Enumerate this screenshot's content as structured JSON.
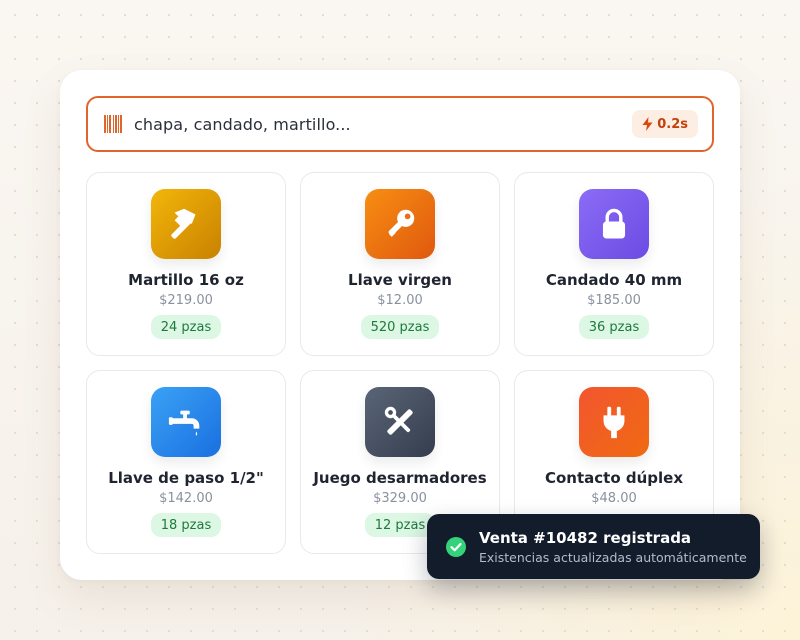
{
  "search": {
    "query": "chapa, candado, martillo...",
    "speed": "0.2s",
    "accent": "#e0652a"
  },
  "products": [
    {
      "name": "Martillo 16 oz",
      "price": "$219.00",
      "stock": "24 pzas",
      "icon": "hammer-icon",
      "gradient": [
        "#f2b60a",
        "#c98100"
      ]
    },
    {
      "name": "Llave virgen",
      "price": "$12.00",
      "stock": "520 pzas",
      "icon": "key-icon",
      "gradient": [
        "#f78e12",
        "#e0580f"
      ]
    },
    {
      "name": "Candado 40 mm",
      "price": "$185.00",
      "stock": "36 pzas",
      "icon": "padlock-icon",
      "gradient": [
        "#8b6cf6",
        "#6c4be3"
      ]
    },
    {
      "name": "Llave de paso 1/2\"",
      "price": "$142.00",
      "stock": "18 pzas",
      "icon": "faucet-icon",
      "gradient": [
        "#3aa2f5",
        "#1a6fe0"
      ]
    },
    {
      "name": "Juego desarmadores",
      "price": "$329.00",
      "stock": "12 pzas",
      "icon": "tools-icon",
      "gradient": [
        "#5a6577",
        "#343d4d"
      ]
    },
    {
      "name": "Contacto dúplex",
      "price": "$48.00",
      "stock": "",
      "icon": "plug-icon",
      "gradient": [
        "#f2562f",
        "#f06a12"
      ]
    }
  ],
  "toast": {
    "title": "Venta #10482 registrada",
    "subtitle": "Existencias actualizadas automáticamente",
    "status_color": "#34d27a"
  },
  "colors": {
    "stock_bg": "#dcf7e4",
    "stock_text": "#1e7a3c"
  }
}
